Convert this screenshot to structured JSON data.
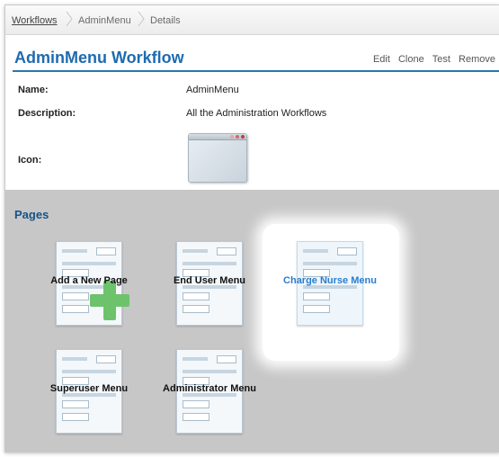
{
  "breadcrumb": {
    "items": [
      "Workflows",
      "AdminMenu",
      "Details"
    ]
  },
  "header": {
    "title": "AdminMenu Workflow",
    "actions": [
      "Edit",
      "Clone",
      "Test",
      "Remove"
    ]
  },
  "details": {
    "name_label": "Name:",
    "name_value": "AdminMenu",
    "description_label": "Description:",
    "description_value": "All the Administration Workflows",
    "icon_label": "Icon:",
    "icon_name": "window-icon"
  },
  "pages": {
    "title": "Pages",
    "tiles": [
      {
        "label": "Add a New Page",
        "icon": "page-thumbnail-icon",
        "badge": "plus-icon"
      },
      {
        "label": "End User Menu",
        "icon": "page-thumbnail-icon"
      },
      {
        "label": "Charge Nurse Menu",
        "icon": "page-thumbnail-icon",
        "highlighted": true
      },
      {
        "label": "Superuser Menu",
        "icon": "page-thumbnail-icon"
      },
      {
        "label": "Administrator Menu",
        "icon": "page-thumbnail-icon"
      }
    ]
  },
  "colors": {
    "accent": "#1e6bb0",
    "highlight_label": "#2a7dcf",
    "add_plus": "#6dc36b"
  }
}
